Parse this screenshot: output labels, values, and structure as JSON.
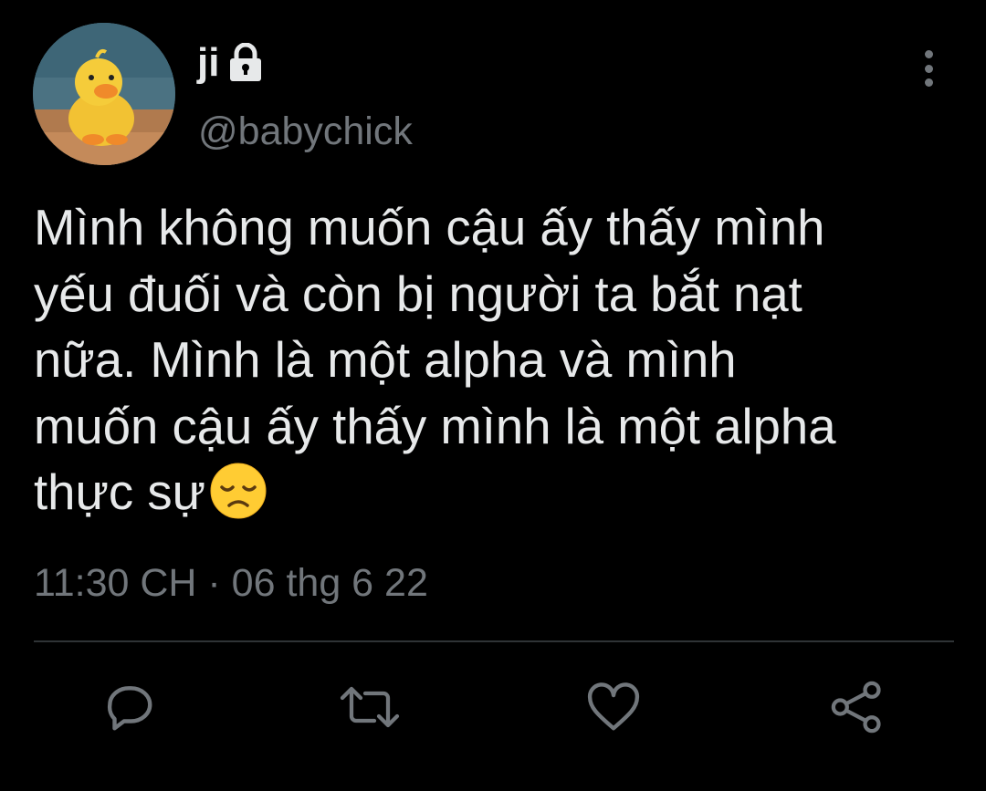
{
  "user": {
    "display_name": "ji",
    "handle": "@babychick",
    "protected_icon": "lock-icon",
    "avatar": "duckling-photo"
  },
  "tweet": {
    "text_lines": [
      "Mình không muốn cậu ấy thấy mình",
      "yếu đuối và còn bị người ta bắt nạt",
      "nữa. Mình là một alpha và mình",
      "muốn cậu ấy thấy mình là một alpha",
      "thực sự"
    ],
    "emoji": "disappointed-face",
    "timestamp": "11:30 CH · 06 thg 6 22"
  },
  "actions": [
    {
      "name": "reply",
      "icon": "reply-icon"
    },
    {
      "name": "retweet",
      "icon": "retweet-icon"
    },
    {
      "name": "like",
      "icon": "heart-icon"
    },
    {
      "name": "share",
      "icon": "share-icon"
    }
  ],
  "colors": {
    "background": "#000000",
    "text": "#e7e9ea",
    "secondary": "#71767b",
    "divider": "#2f3336"
  }
}
